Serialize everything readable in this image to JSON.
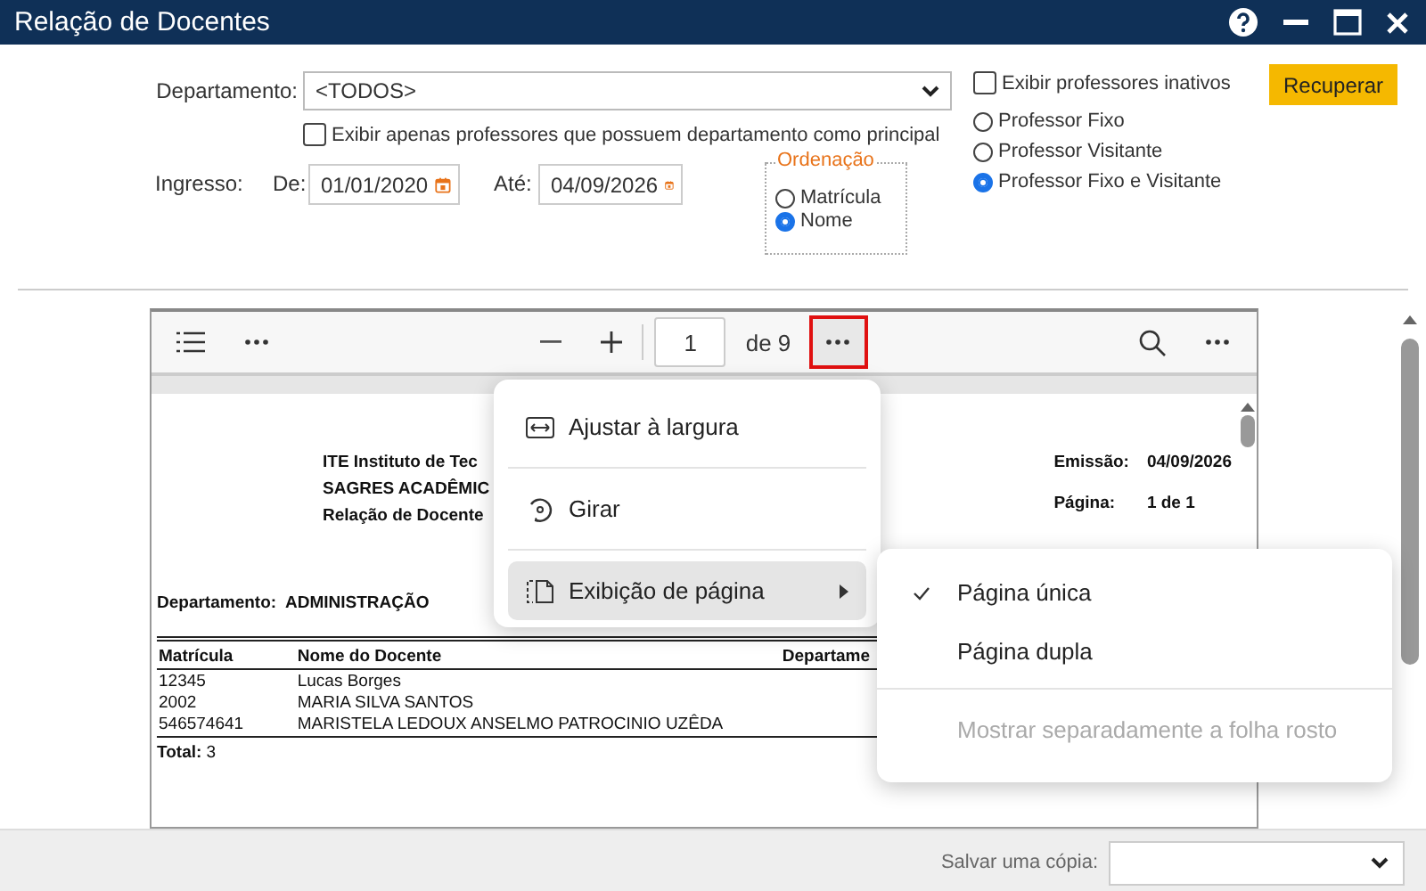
{
  "window": {
    "title": "Relação de Docentes"
  },
  "form": {
    "department": {
      "label": "Departamento:",
      "value": "<TODOS>"
    },
    "principal_only": {
      "label": "Exibir apenas professores que possuem departamento como principal",
      "checked": false
    },
    "inactive": {
      "label": "Exibir professores inativos",
      "checked": false
    },
    "admission": {
      "label": "Ingresso:",
      "from": {
        "label": "De:",
        "value": "01/01/2020"
      },
      "to": {
        "label": "Até:",
        "value": "04/09/2026"
      }
    },
    "ordering": {
      "title": "Ordenação",
      "options": [
        {
          "label": "Matrícula",
          "selected": false
        },
        {
          "label": "Nome",
          "selected": true
        }
      ]
    },
    "professor_type": [
      {
        "label": "Professor Fixo",
        "selected": false
      },
      {
        "label": "Professor Visitante",
        "selected": false
      },
      {
        "label": "Professor Fixo e Visitante",
        "selected": true
      }
    ],
    "recover_button": "Recuperar"
  },
  "viewer": {
    "toolbar": {
      "page": "1",
      "page_count": "de 9",
      "more_highlighted": true
    },
    "document": {
      "header_lines": [
        "ITE Instituto de Tec",
        "SAGRES ACADÊMIC",
        "Relação de Docente"
      ],
      "meta": [
        {
          "label": "Emissão:",
          "value": "04/09/2026"
        },
        {
          "label": "Página:",
          "value": "1 de 1"
        }
      ],
      "department": {
        "label": "Departamento:",
        "value": "ADMINISTRAÇÃO"
      },
      "table": {
        "columns": [
          "Matrícula",
          "Nome do Docente",
          "Departame"
        ],
        "rows": [
          [
            "12345",
            "Lucas Borges"
          ],
          [
            "2002",
            "MARIA SILVA SANTOS"
          ],
          [
            "546574641",
            "MARISTELA LEDOUX ANSELMO PATROCINIO UZÊDA"
          ]
        ]
      },
      "total": {
        "label": "Total:",
        "value": "3"
      }
    },
    "menu": [
      {
        "label": "Ajustar à largura",
        "kind": "fit",
        "selected": false,
        "submenu": false
      },
      {
        "label": "Girar",
        "kind": "rotate",
        "selected": false,
        "submenu": false
      },
      {
        "label": "Exibição de página",
        "kind": "layout",
        "selected": true,
        "submenu": true
      }
    ],
    "submenu": [
      {
        "label": "Página única",
        "checked": true,
        "disabled": false
      },
      {
        "label": "Página dupla",
        "checked": false,
        "disabled": false
      },
      {
        "label": "Mostrar separadamente a folha rosto",
        "checked": false,
        "disabled": true
      }
    ]
  },
  "save": {
    "label": "Salvar uma cópia:"
  }
}
